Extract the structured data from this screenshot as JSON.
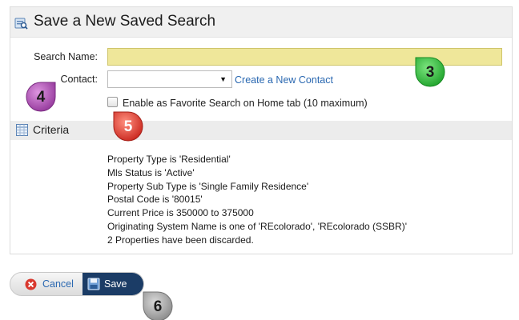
{
  "dialog": {
    "title": "Save a New Saved Search",
    "title_icon": "saved-search-icon"
  },
  "form": {
    "search_name_label": "Search Name:",
    "search_name_value": "",
    "contact_label": "Contact:",
    "contact_selected": "",
    "create_contact_link": "Create a New Contact",
    "favorite_checkbox_label": "Enable as Favorite Search on Home tab (10 maximum)",
    "favorite_checked": false
  },
  "criteria": {
    "title": "Criteria",
    "icon": "table-grid-icon",
    "lines": [
      "Property Type is 'Residential'",
      "Mls Status is 'Active'",
      "Property Sub Type is 'Single Family Residence'",
      "Postal Code is '80015'",
      "Current Price is 350000 to 375000",
      "Originating System Name is one of 'REcolorado', 'REcolorado (SSBR)'",
      "2 Properties have been discarded."
    ]
  },
  "actions": {
    "cancel_label": "Cancel",
    "cancel_icon": "cancel-icon",
    "save_label": "Save",
    "save_icon": "floppy-disk-icon"
  },
  "callouts": {
    "badge_3": "3",
    "badge_4": "4",
    "badge_5": "5",
    "badge_6": "6"
  },
  "colors": {
    "name_field_bg": "#efe79a",
    "link": "#2a68b1",
    "save_button_bg": "#1b3c66",
    "badge_3": "#2fbf3a",
    "badge_4": "#b254b8",
    "badge_5": "#e3423a",
    "badge_6": "#9a9a9a"
  }
}
